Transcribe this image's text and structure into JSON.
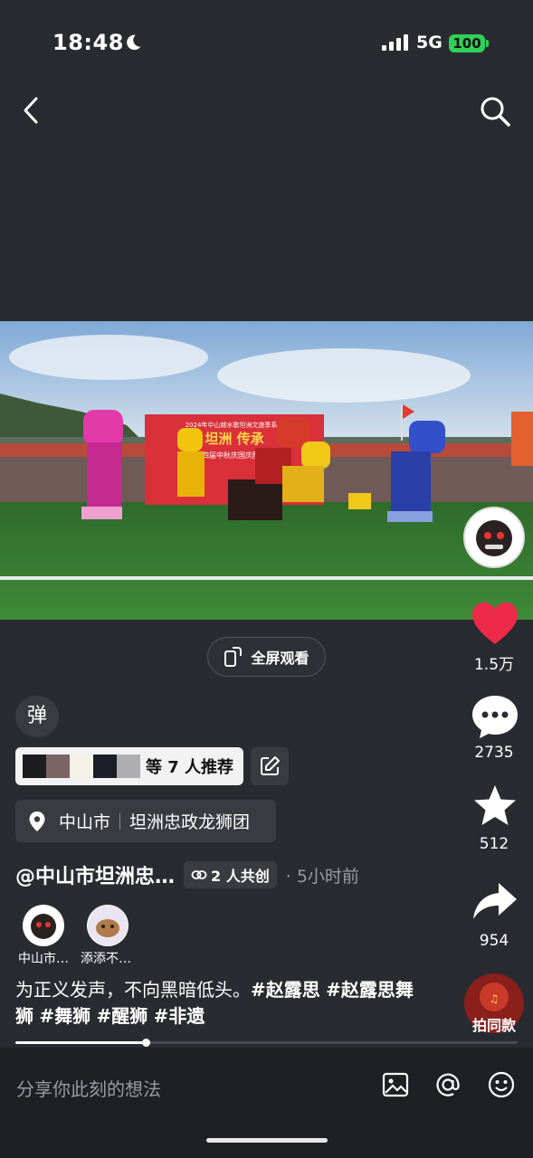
{
  "status": {
    "time": "18:48",
    "network": "5G",
    "battery": "100"
  },
  "video": {
    "banner_title": "2024年中山越水歌坦洲文旅季系列",
    "banner_main": "坦洲 传承",
    "banner_sub": "第四届中秋庆国庆醒狮汇"
  },
  "fullscreen": {
    "label": "全屏观看"
  },
  "rail": {
    "likes": "1.5万",
    "comments": "2735",
    "favorites": "512",
    "shares": "954",
    "pai_label": "拍同款"
  },
  "danmu": {
    "label": "弹"
  },
  "recommend": {
    "text": "等 7 人推荐"
  },
  "location": {
    "city": "中山市",
    "place": "坦洲忠政龙狮团"
  },
  "author": {
    "name": "@中山市坦洲忠…",
    "cocreate": "2 人共创",
    "time": "· 5小时前"
  },
  "cocreators": [
    {
      "name": "中山市…"
    },
    {
      "name": "添添不…"
    }
  ],
  "description": {
    "text": "为正义发声，不向黑暗低头。",
    "tags": [
      "#赵露思",
      "#赵露思舞狮",
      "#舞狮",
      "#醒狮",
      "#非遗"
    ]
  },
  "progress": {
    "fraction": 0.26
  },
  "comment_bar": {
    "placeholder": "分享你此刻的想法"
  },
  "colors": {
    "background": "#2a2b31",
    "like": "#ee2a4a",
    "battery": "#2fd158"
  }
}
